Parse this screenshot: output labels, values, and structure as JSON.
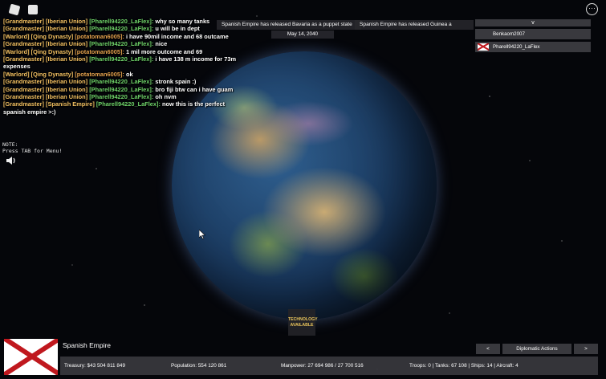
{
  "chat": [
    {
      "tags": [
        "[Grandmaster]",
        "[Iberian Union]"
      ],
      "user": "[Pharell94220_LaFlex]:",
      "user_color": "green",
      "message": "why so many tanks"
    },
    {
      "tags": [
        "[Grandmaster]",
        "[Iberian Union]"
      ],
      "user": "[Pharell94220_LaFlex]:",
      "user_color": "green",
      "message": "u will be in dept"
    },
    {
      "tags": [
        "[Warlord]",
        "[Qing Dynasty]"
      ],
      "user": "[potatoman6005]:",
      "user_color": "orange",
      "message": "i have 90mil income and 68 outcame"
    },
    {
      "tags": [
        "[Grandmaster]",
        "[Iberian Union]"
      ],
      "user": "[Pharell94220_LaFlex]:",
      "user_color": "green",
      "message": "nice"
    },
    {
      "tags": [
        "[Warlord]",
        "[Qing Dynasty]"
      ],
      "user": "[potatoman6005]:",
      "user_color": "orange",
      "message": "1 mil more outcome and 69"
    },
    {
      "tags": [
        "[Grandmaster]",
        "[Iberian Union]"
      ],
      "user": "[Pharell94220_LaFlex]:",
      "user_color": "green",
      "message": "i have 138 m income for 73m expenses"
    },
    {
      "tags": [
        "[Warlord]",
        "[Qing Dynasty]"
      ],
      "user": "[potatoman6005]:",
      "user_color": "orange",
      "message": "ok"
    },
    {
      "tags": [
        "[Grandmaster]",
        "[Iberian Union]"
      ],
      "user": "[Pharell94220_LaFlex]:",
      "user_color": "green",
      "message": "stronk spain :)"
    },
    {
      "tags": [
        "[Grandmaster]",
        "[Iberian Union]"
      ],
      "user": "[Pharell94220_LaFlex]:",
      "user_color": "green",
      "message": "bro fiji btw can i have guam"
    },
    {
      "tags": [
        "[Grandmaster]",
        "[Iberian Union]"
      ],
      "user": "[Pharell94220_LaFlex]:",
      "user_color": "green",
      "message": "oh nvm"
    },
    {
      "tags": [
        "[Grandmaster]",
        "[Spanish Empire]"
      ],
      "user": "[Pharell94220_LaFlex]:",
      "user_color": "green",
      "message": "now this is the perfect spanish empire >:)"
    }
  ],
  "note": {
    "line1": "NOTE:",
    "line2": "Press TAB for Menu!"
  },
  "notifications": [
    "Spanish Empire has released Bavaria as a puppet state",
    "Spanish Empire has released Guinea a"
  ],
  "date": "May 14, 2040",
  "players": {
    "toggle": "v",
    "list": [
      {
        "name": "Benkaom2007",
        "has_flag": false
      },
      {
        "name": "Pharell94220_LaFlex",
        "has_flag": true
      }
    ]
  },
  "tech": {
    "line1": "TECHNOLOGY",
    "line2": "AVAILABLE"
  },
  "country": {
    "name": "Spanish Empire"
  },
  "stats": {
    "treasury": "Treasury:  $43 504 811 849",
    "population": "Population: 554 120 861",
    "manpower": "Manpower:  27 694 986  /  27 700 516",
    "military": "Troops: 0  |  Tanks: 67 108  |  Ships: 14  |  Aircraft: 4"
  },
  "diplomacy": {
    "prev": "<",
    "label": "Diplomatic Actions",
    "next": ">"
  },
  "colors": {
    "flag_red": "#c0181e",
    "tag_gold": "#f2c062",
    "user_green": "#6fd36a",
    "tech_gold": "#e9c45b"
  },
  "icons": {
    "top_left": [
      "roblox-icon",
      "chat-icon"
    ],
    "top_right": "menu-icon",
    "audio": "speaker-icon"
  }
}
